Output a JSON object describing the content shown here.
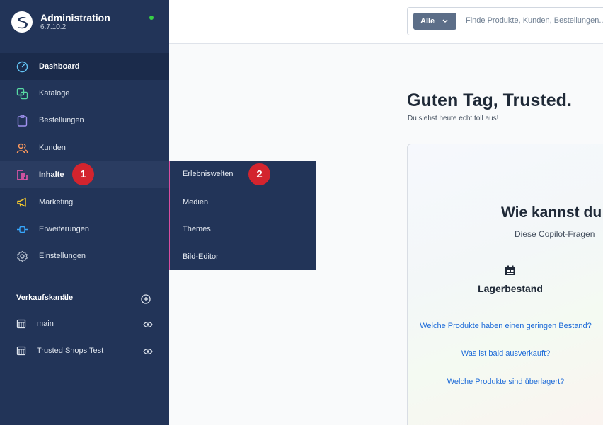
{
  "app": {
    "title": "Administration",
    "version": "6.7.10.2"
  },
  "nav": {
    "items": [
      {
        "label": "Dashboard",
        "icon": "gauge-icon"
      },
      {
        "label": "Kataloge",
        "icon": "catalog-icon"
      },
      {
        "label": "Bestellungen",
        "icon": "clipboard-icon"
      },
      {
        "label": "Kunden",
        "icon": "customers-icon"
      },
      {
        "label": "Inhalte",
        "icon": "content-icon"
      },
      {
        "label": "Marketing",
        "icon": "megaphone-icon"
      },
      {
        "label": "Erweiterungen",
        "icon": "plug-icon"
      },
      {
        "label": "Einstellungen",
        "icon": "gear-icon"
      }
    ],
    "badge_1": "1"
  },
  "sales_channels": {
    "title": "Verkaufskanäle",
    "items": [
      {
        "label": "main"
      },
      {
        "label": "Trusted Shops Test"
      }
    ]
  },
  "flyout": {
    "items": [
      {
        "label": "Erlebniswelten"
      },
      {
        "label": "Medien"
      },
      {
        "label": "Themes"
      },
      {
        "label": "Bild-Editor"
      }
    ],
    "badge_2": "2"
  },
  "search": {
    "filter_label": "Alle",
    "placeholder": "Finde Produkte, Kunden, Bestellungen..."
  },
  "main": {
    "greeting": "Guten Tag, Trusted.",
    "greeting_sub": "Du siehst heute echt toll aus!",
    "copilot": {
      "title": "Wie kannst du",
      "subtitle": "Diese Copilot-Fragen",
      "category": "Lagerbestand",
      "questions": [
        "Welche Produkte haben einen geringen Bestand?",
        "Was ist bald ausverkauft?",
        "Welche Produkte sind überlagert?"
      ]
    }
  },
  "colors": {
    "sidebar": "#223458",
    "accent_red": "#d3242e",
    "link": "#1c6ad8"
  }
}
